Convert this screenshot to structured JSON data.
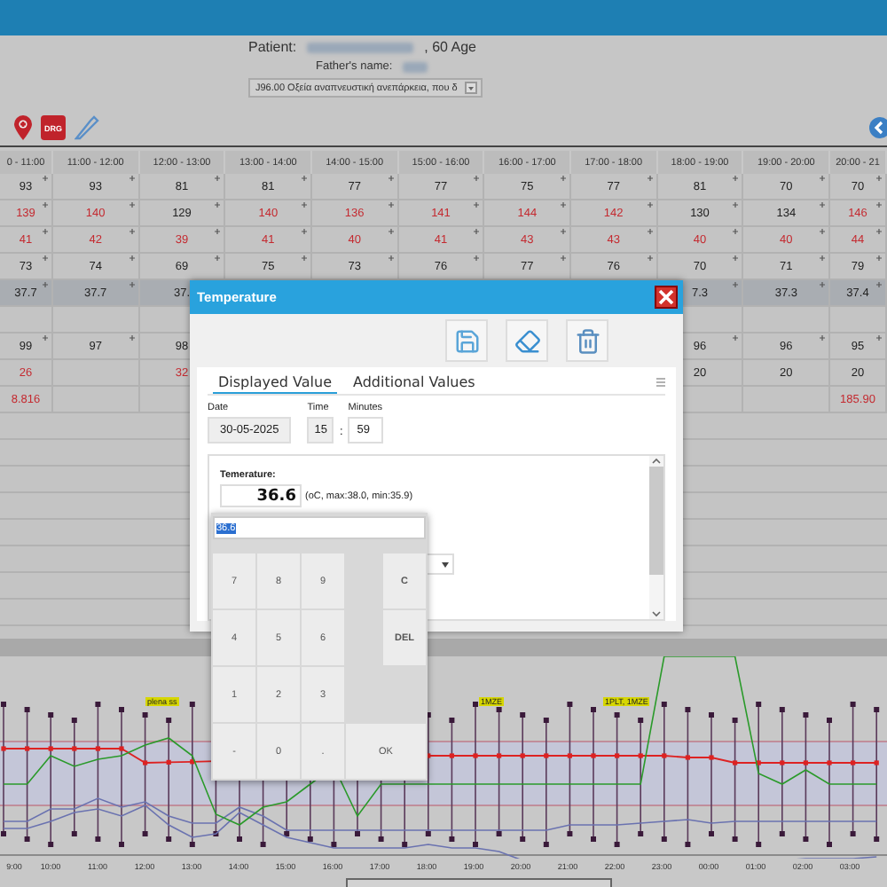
{
  "patient": {
    "label": "Patient:",
    "age": ", 60  Age",
    "father_label": "Father's name:"
  },
  "diagnosis_select": {
    "value": "J96.00 Οξεία αναπνευστική ανεπάρκεια, που δ"
  },
  "toolbar": {
    "badge": "DRG"
  },
  "table": {
    "columns": [
      "0 - 11:00",
      "11:00 - 12:00",
      "12:00 - 13:00",
      "13:00 - 14:00",
      "14:00 - 15:00",
      "15:00 - 16:00",
      "16:00 - 17:00",
      "17:00 - 18:00",
      "18:00 - 19:00",
      "19:00 - 20:00",
      "20:00 - 21"
    ],
    "rows": [
      {
        "highlighted": false,
        "plus": true,
        "cells": [
          {
            "text": "93",
            "alert": false
          },
          {
            "text": "93",
            "alert": false
          },
          {
            "text": "81",
            "alert": false
          },
          {
            "text": "81",
            "alert": false
          },
          {
            "text": "77",
            "alert": false
          },
          {
            "text": "77",
            "alert": false
          },
          {
            "text": "75",
            "alert": false
          },
          {
            "text": "77",
            "alert": false
          },
          {
            "text": "81",
            "alert": false
          },
          {
            "text": "70",
            "alert": false
          },
          {
            "text": "70",
            "alert": false
          }
        ]
      },
      {
        "highlighted": false,
        "plus": true,
        "cells": [
          {
            "text": "139",
            "alert": true
          },
          {
            "text": "140",
            "alert": true
          },
          {
            "text": "129",
            "alert": false
          },
          {
            "text": "140",
            "alert": true
          },
          {
            "text": "136",
            "alert": true
          },
          {
            "text": "141",
            "alert": true
          },
          {
            "text": "144",
            "alert": true
          },
          {
            "text": "142",
            "alert": true
          },
          {
            "text": "130",
            "alert": false
          },
          {
            "text": "134",
            "alert": false
          },
          {
            "text": "146",
            "alert": true
          }
        ]
      },
      {
        "highlighted": false,
        "plus": true,
        "cells": [
          {
            "text": "41",
            "alert": true
          },
          {
            "text": "42",
            "alert": true
          },
          {
            "text": "39",
            "alert": true
          },
          {
            "text": "41",
            "alert": true
          },
          {
            "text": "40",
            "alert": true
          },
          {
            "text": "41",
            "alert": true
          },
          {
            "text": "43",
            "alert": true
          },
          {
            "text": "43",
            "alert": true
          },
          {
            "text": "40",
            "alert": true
          },
          {
            "text": "40",
            "alert": true
          },
          {
            "text": "44",
            "alert": true
          }
        ]
      },
      {
        "highlighted": false,
        "plus": true,
        "cells": [
          {
            "text": "73",
            "alert": false
          },
          {
            "text": "74",
            "alert": false
          },
          {
            "text": "69",
            "alert": false
          },
          {
            "text": "75",
            "alert": false
          },
          {
            "text": "73",
            "alert": false
          },
          {
            "text": "76",
            "alert": false
          },
          {
            "text": "77",
            "alert": false
          },
          {
            "text": "76",
            "alert": false
          },
          {
            "text": "70",
            "alert": false
          },
          {
            "text": "71",
            "alert": false
          },
          {
            "text": "79",
            "alert": false
          }
        ]
      },
      {
        "highlighted": true,
        "plus": true,
        "cells": [
          {
            "text": "37.7",
            "alert": false
          },
          {
            "text": "37.7",
            "alert": false
          },
          {
            "text": "37.",
            "alert": false
          },
          null,
          null,
          null,
          null,
          null,
          {
            "text": "7.3",
            "alert": false
          },
          {
            "text": "37.3",
            "alert": false
          },
          {
            "text": "37.4",
            "alert": false
          }
        ]
      },
      {
        "highlighted": false,
        "plus": false,
        "cells": [
          null,
          null,
          null,
          null,
          null,
          null,
          null,
          null,
          null,
          null,
          null
        ]
      },
      {
        "highlighted": false,
        "plus": true,
        "cells": [
          {
            "text": "99",
            "alert": false
          },
          {
            "text": "97",
            "alert": false
          },
          {
            "text": "98",
            "alert": false
          },
          null,
          null,
          null,
          null,
          null,
          {
            "text": "96",
            "alert": false
          },
          {
            "text": "96",
            "alert": false
          },
          {
            "text": "95",
            "alert": false
          }
        ]
      },
      {
        "highlighted": false,
        "plus": false,
        "cells": [
          {
            "text": "26",
            "alert": true
          },
          null,
          {
            "text": "32",
            "alert": true
          },
          null,
          null,
          null,
          null,
          null,
          {
            "text": "20",
            "alert": false
          },
          {
            "text": "20",
            "alert": false
          },
          {
            "text": "20",
            "alert": false
          }
        ]
      },
      {
        "highlighted": false,
        "plus": false,
        "cells": [
          {
            "text": "8.816",
            "alert": true
          },
          null,
          null,
          null,
          null,
          null,
          null,
          null,
          null,
          null,
          {
            "text": "185.90",
            "alert": true
          }
        ]
      }
    ]
  },
  "dialog": {
    "title": "Temperature",
    "tabs": [
      {
        "label": "Displayed Value",
        "selected": true
      },
      {
        "label": "Additional Values",
        "selected": false
      }
    ],
    "date": {
      "label": "Date",
      "value": "30-05-2025"
    },
    "time": {
      "label": "Time",
      "value": "15"
    },
    "separator": ":",
    "minutes": {
      "label": "Minutes",
      "value": "59"
    },
    "measurement": {
      "label": "Temerature:",
      "value": "36.6",
      "range": "(oC, max:38.0, min:35.9)"
    }
  },
  "keypad": {
    "input": "36.6",
    "keys": [
      {
        "label": "7",
        "kind": "digit"
      },
      {
        "label": "8",
        "kind": "digit"
      },
      {
        "label": "9",
        "kind": "digit"
      },
      {
        "label": "C",
        "kind": "action"
      },
      {
        "label": "4",
        "kind": "digit"
      },
      {
        "label": "5",
        "kind": "digit"
      },
      {
        "label": "6",
        "kind": "digit"
      },
      {
        "label": "DEL",
        "kind": "action"
      },
      {
        "label": "1",
        "kind": "digit"
      },
      {
        "label": "2",
        "kind": "digit"
      },
      {
        "label": "3",
        "kind": "digit"
      },
      {
        "label": "-",
        "kind": "digit"
      },
      {
        "label": "0",
        "kind": "digit"
      },
      {
        "label": ".",
        "kind": "digit"
      },
      {
        "label": "OK",
        "kind": "wide"
      }
    ]
  },
  "chart": {
    "annotations": [
      "plena ss",
      "1MZE",
      "1PLT, 1MZE"
    ],
    "time_labels": [
      "9:00",
      "10:00",
      "11:00",
      "12:00",
      "13:00",
      "14:00",
      "15:00",
      "16:00",
      "17:00",
      "18:00",
      "19:00",
      "20:00",
      "21:00",
      "22:00",
      "23:00",
      "00:00",
      "01:00",
      "02:00",
      "03:00"
    ]
  }
}
